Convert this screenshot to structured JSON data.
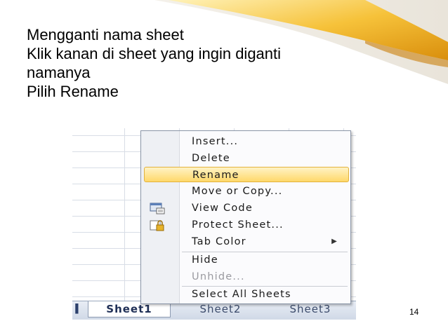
{
  "slide": {
    "title": "Mengganti nama sheet",
    "lines": [
      " Klik kanan di sheet yang ingin diganti",
      "namanya",
      " Pilih Rename"
    ],
    "page_number": "14"
  },
  "context_menu": {
    "items": [
      {
        "label": "Insert..."
      },
      {
        "label": "Delete"
      },
      {
        "label": "Rename",
        "highlighted": true
      },
      {
        "label": "Move or Copy..."
      },
      {
        "label": "View Code",
        "icon": "view-code-icon"
      },
      {
        "label": "Protect Sheet...",
        "icon": "protect-sheet-icon"
      },
      {
        "label": "Tab Color",
        "submenu": true
      },
      {
        "label": "Hide"
      },
      {
        "label": "Unhide...",
        "disabled": true
      },
      {
        "label": "Select All Sheets"
      }
    ]
  },
  "sheet_tabs": [
    "Sheet1",
    "Sheet2",
    "Sheet3"
  ],
  "colors": {
    "highlight": "#ffd86a",
    "accent_gold": "#f2b21a"
  }
}
